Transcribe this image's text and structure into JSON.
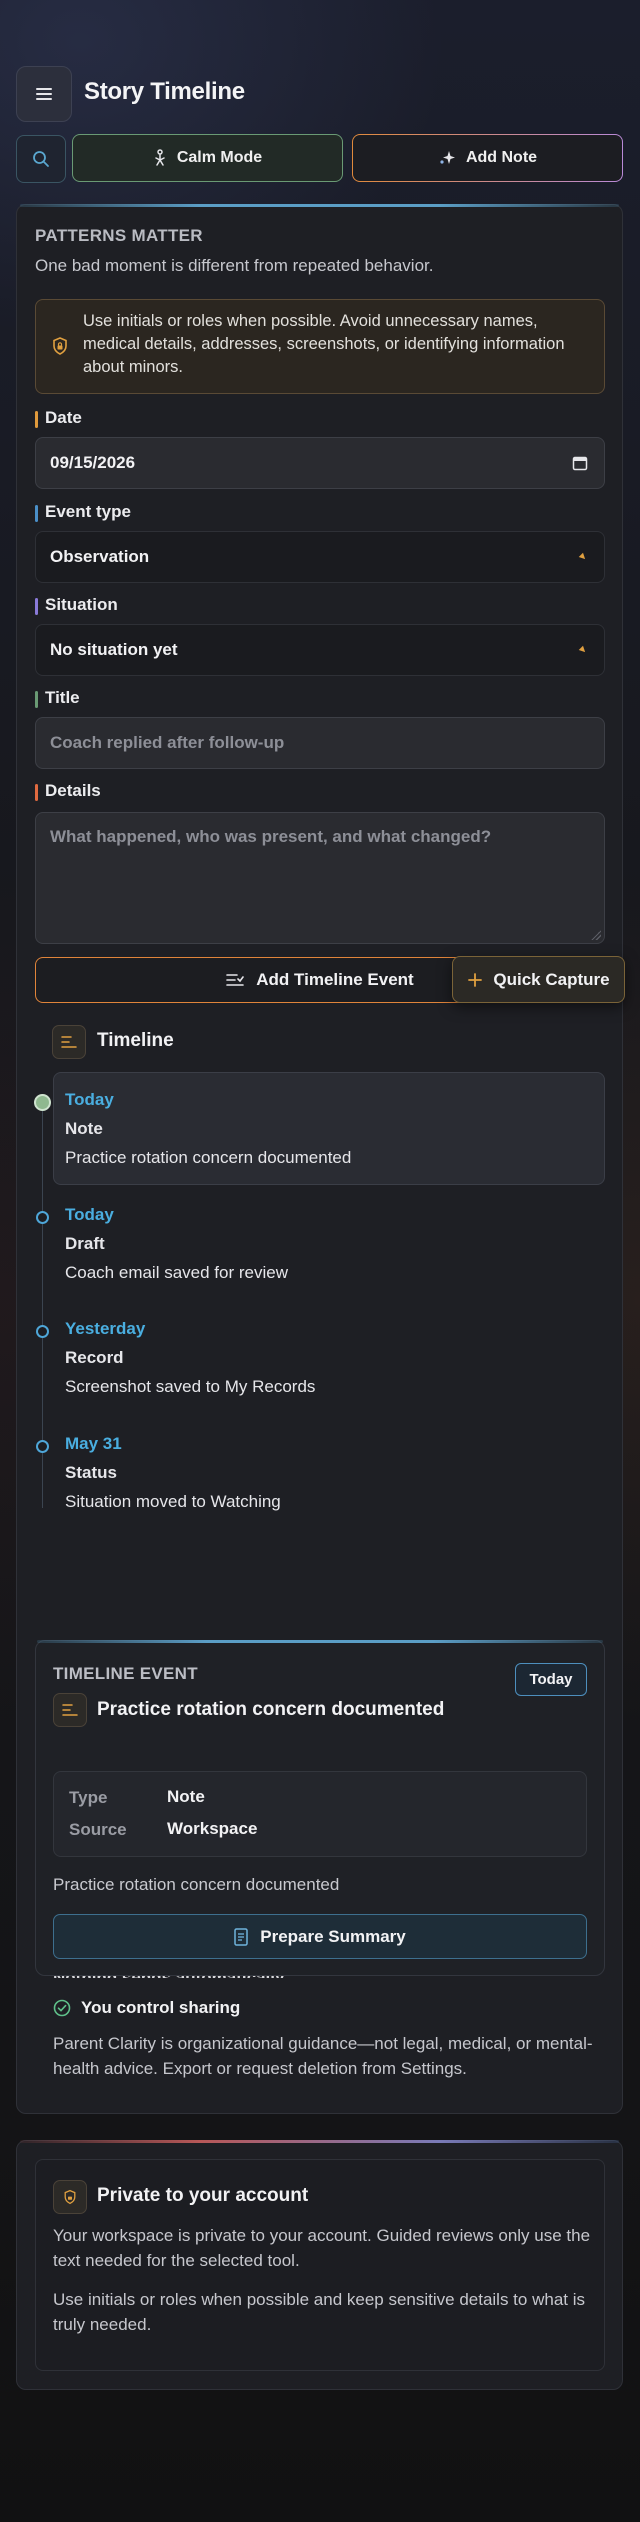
{
  "header": {
    "title": "Story Timeline",
    "calm_mode_label": "Calm Mode",
    "add_note_label": "Add Note"
  },
  "form": {
    "kicker": "PATTERNS MATTER",
    "subtitle": "One bad moment is different from repeated behavior.",
    "notice": "Use initials or roles when possible. Avoid unnecessary names, medical details, addresses, screenshots, or identifying information about minors.",
    "date_label": "Date",
    "date_value": "09/15/2026",
    "event_type_label": "Event type",
    "event_type_value": "Observation",
    "situation_label": "Situation",
    "situation_value": "No situation yet",
    "title_label": "Title",
    "title_placeholder": "Coach replied after follow-up",
    "details_label": "Details",
    "details_placeholder": "What happened, who was present, and what changed?",
    "add_event_label": "Add Timeline Event",
    "quick_capture_label": "Quick Capture"
  },
  "timeline": {
    "heading": "Timeline",
    "items": [
      {
        "date": "Today",
        "type": "Note",
        "desc": "Practice rotation concern documented"
      },
      {
        "date": "Today",
        "type": "Draft",
        "desc": "Coach email saved for review"
      },
      {
        "date": "Yesterday",
        "type": "Record",
        "desc": "Screenshot saved to My Records"
      },
      {
        "date": "May 31",
        "type": "Status",
        "desc": "Situation moved to Watching"
      }
    ]
  },
  "detail": {
    "kicker": "TIMELINE EVENT",
    "badge": "Today",
    "title": "Practice rotation concern documented",
    "type_key": "Type",
    "type_value": "Note",
    "source_key": "Source",
    "source_value": "Workspace",
    "description": "Practice rotation concern documented",
    "prepare_label": "Prepare Summary"
  },
  "footer_notes": {
    "peek": "Nothing sends automatically",
    "control": "You control sharing",
    "disclaimer": "Parent Clarity is organizational guidance—not legal, medical, or mental-health advice. Export or request deletion from Settings."
  },
  "privacy": {
    "title": "Private to your account",
    "p1": "Your workspace is private to your account. Guided reviews only use the text needed for the selected tool.",
    "p2": "Use initials or roles when possible and keep sensitive details to what is truly needed."
  },
  "colors": {
    "accent_blue": "#4aaee0",
    "accent_orange": "#e0843a",
    "accent_green": "#6a9a74"
  }
}
